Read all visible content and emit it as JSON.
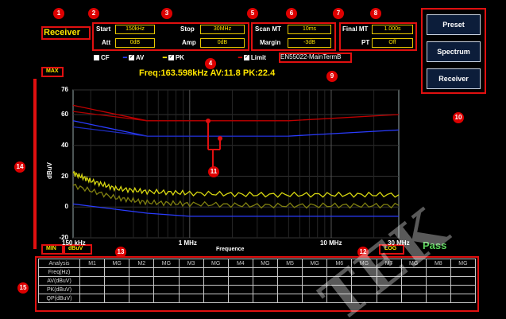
{
  "mode": {
    "title": "Receiver"
  },
  "sweep": {
    "start_label": "Start",
    "start_value": "150kHz",
    "stop_label": "Stop",
    "stop_value": "30MHz",
    "att_label": "Att",
    "att_value": "0dB",
    "amp_label": "Amp",
    "amp_value": "0dB",
    "scan_mt_label": "Scan MT",
    "scan_mt_value": "10ms",
    "margin_label": "Margin",
    "margin_value": "-3dB",
    "final_mt_label": "Final MT",
    "final_mt_value": "1.000s",
    "pt_label": "PT",
    "pt_value": "Off"
  },
  "detectors": {
    "cf_label": "CF",
    "cf_checked": false,
    "av_label": "AV",
    "av_checked": true,
    "pk_label": "PK",
    "pk_checked": true,
    "limit_label": "Limit",
    "limit_checked": true,
    "limit_name": "EN55022-MainTermB"
  },
  "readout": {
    "text": "Freq:163.598kHz  AV:11.8  PK:22.4"
  },
  "right_panel": {
    "preset": "Preset",
    "spectrum": "Spectrum",
    "receiver": "Receiver"
  },
  "markers": [
    "1",
    "2",
    "3",
    "4",
    "5",
    "6",
    "7",
    "8",
    "9",
    "10",
    "11",
    "12",
    "13",
    "14",
    "15"
  ],
  "axis": {
    "max_label": "MAX",
    "min_label": "MIN",
    "unit_label": "dBuV",
    "scale_label": "LOG",
    "result": "Pass"
  },
  "chart_data": {
    "type": "line",
    "xlabel": "Frequence",
    "ylabel": "dBuV",
    "xscale": "log",
    "xlim": [
      0.15,
      30
    ],
    "ylim": [
      -20,
      76
    ],
    "yticks": [
      "76",
      "60",
      "40",
      "20",
      "0",
      "-20"
    ],
    "xticks": [
      "150 kHz",
      "1 MHz",
      "10 MHz",
      "30 MHz"
    ],
    "grid": true,
    "series": [
      {
        "color": "#c00000",
        "points": [
          [
            0.15,
            66
          ],
          [
            0.5,
            56
          ],
          [
            5,
            56
          ],
          [
            30,
            60
          ]
        ]
      },
      {
        "color": "#b00000",
        "points": [
          [
            0.15,
            62
          ],
          [
            0.5,
            56
          ],
          [
            5,
            56
          ]
        ]
      },
      {
        "color": "#2a3cff",
        "points": [
          [
            0.15,
            56
          ],
          [
            0.5,
            46
          ],
          [
            5,
            46
          ],
          [
            30,
            50
          ]
        ]
      },
      {
        "color": "#1e2cc0",
        "points": [
          [
            0.15,
            52
          ],
          [
            0.5,
            46
          ],
          [
            5,
            46
          ]
        ]
      },
      {
        "color": "#2a3cff",
        "points": [
          [
            0.15,
            2
          ],
          [
            0.5,
            -4
          ],
          [
            1,
            -6
          ],
          [
            5,
            -6
          ],
          [
            30,
            -6
          ]
        ]
      },
      {
        "color": "#d8d810",
        "points": [
          [
            0.15,
            22
          ],
          [
            0.2,
            17
          ],
          [
            0.3,
            12
          ],
          [
            0.5,
            10
          ],
          [
            1,
            9
          ],
          [
            3,
            8
          ],
          [
            10,
            8
          ],
          [
            30,
            8
          ]
        ]
      },
      {
        "color": "#808010",
        "points": [
          [
            0.15,
            14
          ],
          [
            0.3,
            6
          ],
          [
            0.5,
            3
          ],
          [
            1,
            2
          ],
          [
            3,
            1
          ],
          [
            10,
            1
          ],
          [
            30,
            1
          ]
        ]
      }
    ]
  },
  "table": {
    "header": [
      "Analysis",
      "M1",
      "MG",
      "M2",
      "MG",
      "M3",
      "MG",
      "M4",
      "MG",
      "M5",
      "MG",
      "M6",
      "MG",
      "M7",
      "MG",
      "M8",
      "MG"
    ],
    "rows": [
      "Freq(Hz)",
      "AV(dBuV)",
      "PK(dBuV)",
      "QP(dBuV)"
    ]
  },
  "watermark": "TEK"
}
